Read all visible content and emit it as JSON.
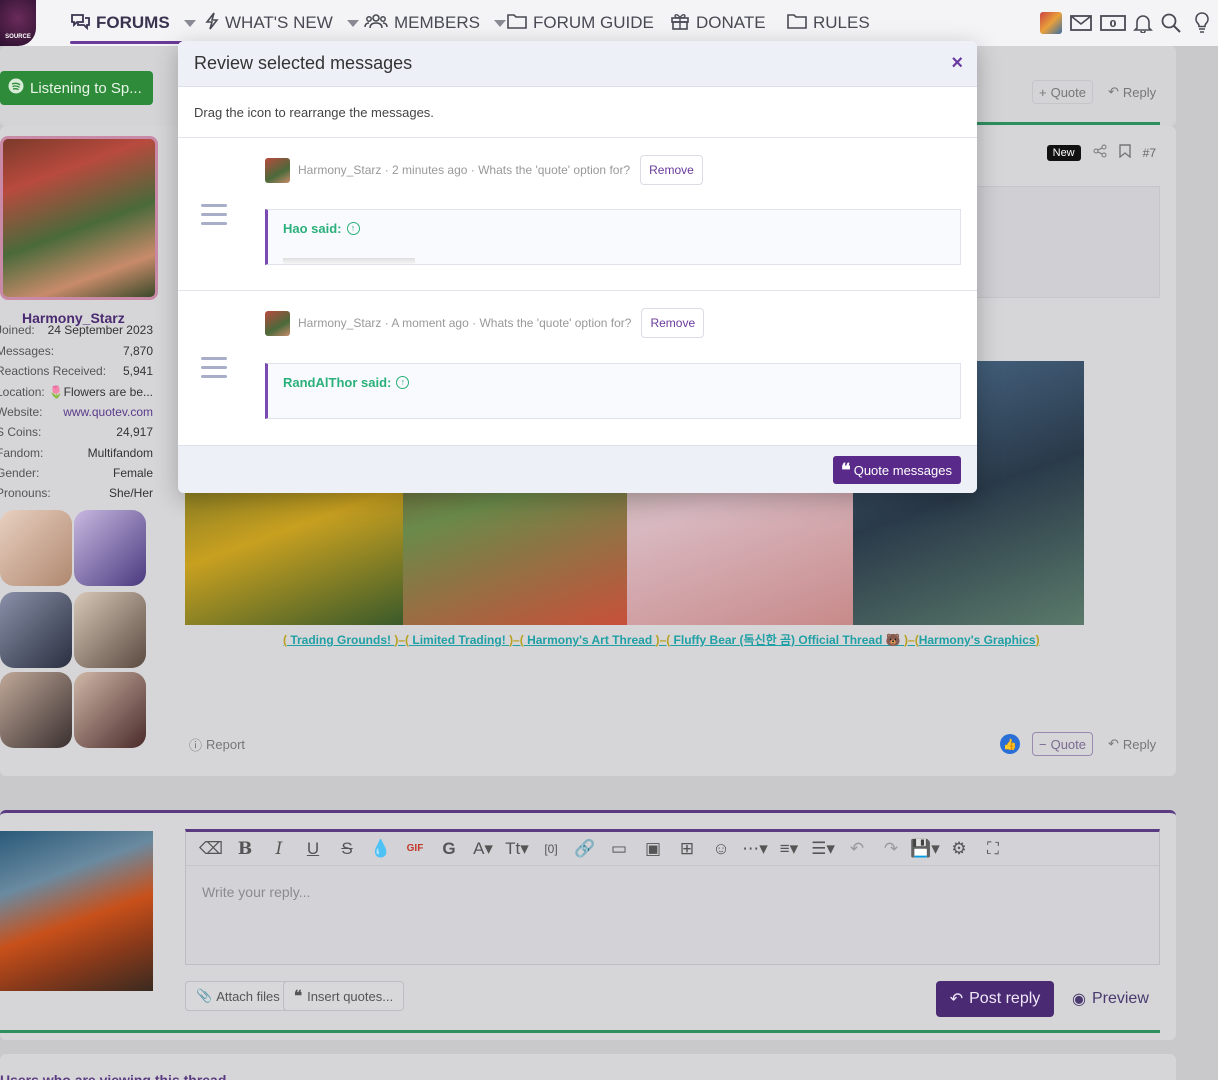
{
  "nav": {
    "items": [
      {
        "label": "FORUMS"
      },
      {
        "label": "WHAT'S NEW"
      },
      {
        "label": "MEMBERS"
      },
      {
        "label": "FORUM GUIDE"
      },
      {
        "label": "DONATE"
      },
      {
        "label": "RULES"
      }
    ],
    "logo_text": "SOURCE"
  },
  "background": {
    "listening": "Listening to Sp...",
    "top_quote": "Quote",
    "top_reply": "Reply",
    "post": {
      "badge": "New",
      "post_number": "#7",
      "username": "Harmony_Starz",
      "stats": [
        {
          "label": "Joined:",
          "value": "24 September 2023"
        },
        {
          "label": "Messages:",
          "value": "7,870"
        },
        {
          "label": "Reactions Received:",
          "value": "5,941"
        },
        {
          "label": "Location:",
          "value": "🌷Flowers are be..."
        },
        {
          "label": "Website:",
          "value": "www.quotev.com"
        },
        {
          "label": "S Coins:",
          "value": "24,917"
        },
        {
          "label": "Fandom:",
          "value": "Multifandom"
        },
        {
          "label": "Gender:",
          "value": "Female"
        },
        {
          "label": "Pronouns:",
          "value": "She/Her"
        }
      ],
      "signature_links": [
        "Trading Grounds!",
        "Limited Trading!",
        "Harmony's Art Thread",
        "Fluffy Bear (독신한 곰) Official Thread 🐻",
        "Harmony's Graphics"
      ],
      "report": "Report",
      "quote": "Quote",
      "reply": "Reply"
    },
    "reply_box": {
      "placeholder": "Write your reply...",
      "attach": "Attach files",
      "insert_quotes": "Insert quotes...",
      "post_reply": "Post reply",
      "preview": "Preview"
    },
    "viewing": "Users who are viewing this thread"
  },
  "modal": {
    "title": "Review selected messages",
    "close": "×",
    "note": "Drag the icon to rearrange the messages.",
    "messages": [
      {
        "author": "Harmony_Starz",
        "time": "2 minutes ago",
        "title": "Whats the 'quote' option for?",
        "remove": "Remove",
        "quoted": "Hao said:"
      },
      {
        "author": "Harmony_Starz",
        "time": "A moment ago",
        "title": "Whats the 'quote' option for?",
        "remove": "Remove",
        "quoted": "RandAlThor said:"
      }
    ],
    "submit": "Quote messages"
  },
  "colors": {
    "accent": "#5a2a8a",
    "quote_green": "#2ab07a",
    "sig_teal": "#1fa0a5"
  }
}
